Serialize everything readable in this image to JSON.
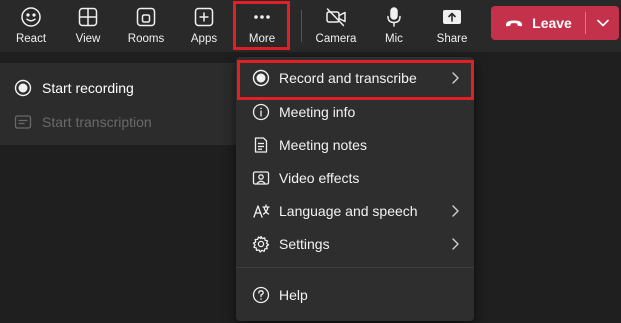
{
  "toolbar": {
    "react": "React",
    "view": "View",
    "rooms": "Rooms",
    "apps": "Apps",
    "more": "More",
    "camera": "Camera",
    "mic": "Mic",
    "share": "Share",
    "leave": "Leave"
  },
  "recording_submenu": {
    "start_recording": "Start recording",
    "start_transcription": "Start transcription"
  },
  "more_menu": {
    "items": [
      {
        "label": "Record and transcribe",
        "icon": "record-icon"
      },
      {
        "label": "Meeting info",
        "icon": "info-icon"
      },
      {
        "label": "Meeting notes",
        "icon": "notes-icon"
      },
      {
        "label": "Video effects",
        "icon": "video-effects-icon"
      },
      {
        "label": "Language and speech",
        "icon": "language-icon"
      },
      {
        "label": "Settings",
        "icon": "gear-icon"
      },
      {
        "label": "Help",
        "icon": "help-icon"
      }
    ]
  },
  "colors": {
    "leave_button": "#c4314b",
    "highlight": "#e01f26",
    "menu_background": "#2e2e2e",
    "toolbar_background": "#292929"
  }
}
